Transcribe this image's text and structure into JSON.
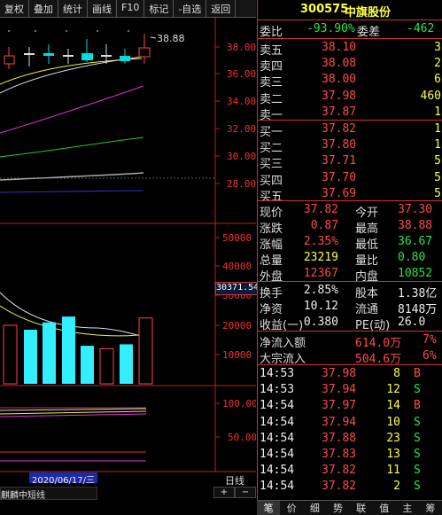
{
  "toolbar": [
    "复权",
    "叠加",
    "统计",
    "画线",
    "F10",
    "标记",
    "-自选",
    "返回"
  ],
  "chart": {
    "price_axis": [
      "38.00",
      "36.00",
      "34.00",
      "32.00",
      "30.00",
      "28.00"
    ],
    "high_marker": "38.88",
    "vol_axis": [
      "50000",
      "40000",
      "30000",
      "20000",
      "10000"
    ],
    "vol_readout": "30371.54",
    "ind_axis": [
      "100.00",
      "50.00"
    ],
    "date_label": "2020/06/17/三",
    "indicator_name": "麒麟中短线",
    "period_label": "日线",
    "volumes": [
      20000,
      18500,
      21000,
      23000,
      13000,
      12000,
      13500,
      22500
    ],
    "vol_colors": [
      "red",
      "cyan",
      "cyan",
      "cyan",
      "cyan",
      "red",
      "cyan",
      "red"
    ]
  },
  "chart_data": {
    "type": "bar",
    "categories": [
      "1",
      "2",
      "3",
      "4",
      "5",
      "6",
      "7",
      "8"
    ],
    "series": [
      {
        "values": [
          20000,
          18500,
          21000,
          23000,
          13000,
          12000,
          13500,
          22500
        ]
      }
    ],
    "ylim": [
      0,
      55000
    ]
  },
  "stock": {
    "code": "300575",
    "name": "中旗股份"
  },
  "ratio": {
    "l1": "委比",
    "v1": "-93.90%",
    "l2": "委差",
    "v2": "-462"
  },
  "asks": [
    {
      "label": "卖五",
      "price": "38.10",
      "vol": "3"
    },
    {
      "label": "卖四",
      "price": "38.08",
      "vol": "2"
    },
    {
      "label": "卖三",
      "price": "38.00",
      "vol": "6"
    },
    {
      "label": "卖二",
      "price": "37.98",
      "vol": "460"
    },
    {
      "label": "卖一",
      "price": "37.87",
      "vol": "1"
    }
  ],
  "bids": [
    {
      "label": "买一",
      "price": "37.82",
      "vol": "1"
    },
    {
      "label": "买二",
      "price": "37.80",
      "vol": "1"
    },
    {
      "label": "买三",
      "price": "37.71",
      "vol": "5"
    },
    {
      "label": "买四",
      "price": "37.70",
      "vol": "5"
    },
    {
      "label": "买五",
      "price": "37.69",
      "vol": "5"
    }
  ],
  "quote": [
    {
      "l1": "现价",
      "v1": "37.82",
      "c1": "red",
      "l2": "今开",
      "v2": "37.30",
      "c2": "red"
    },
    {
      "l1": "涨跌",
      "v1": "0.87",
      "c1": "red",
      "l2": "最高",
      "v2": "38.88",
      "c2": "red"
    },
    {
      "l1": "涨幅",
      "v1": "2.35%",
      "c1": "red",
      "l2": "最低",
      "v2": "36.67",
      "c2": "green"
    },
    {
      "l1": "总量",
      "v1": "23219",
      "c1": "yel",
      "l2": "量比",
      "v2": "0.80",
      "c2": "green"
    },
    {
      "l1": "外盘",
      "v1": "12367",
      "c1": "red",
      "l2": "内盘",
      "v2": "10852",
      "c2": "green"
    }
  ],
  "fundamentals": [
    {
      "l1": "换手",
      "v1": "2.85%",
      "l2": "股本",
      "v2": "1.38亿"
    },
    {
      "l1": "净资",
      "v1": "10.12",
      "l2": "流通",
      "v2": "8148万"
    },
    {
      "l1": "收益(一)",
      "v1": "0.380",
      "l2": "PE(动)",
      "v2": "26.0"
    }
  ],
  "flows": [
    {
      "label": "净流入额",
      "value": "614.0万",
      "pct": "7%"
    },
    {
      "label": "大宗流入",
      "value": "504.6万",
      "pct": "6%"
    }
  ],
  "ticks": [
    {
      "time": "14:53",
      "price": "37.98",
      "vol": "8",
      "dir": "B"
    },
    {
      "time": "14:53",
      "price": "37.94",
      "vol": "12",
      "dir": "S"
    },
    {
      "time": "14:54",
      "price": "37.97",
      "vol": "14",
      "dir": "B"
    },
    {
      "time": "14:54",
      "price": "37.94",
      "vol": "10",
      "dir": "S"
    },
    {
      "time": "14:54",
      "price": "37.88",
      "vol": "23",
      "dir": "S"
    },
    {
      "time": "14:54",
      "price": "37.83",
      "vol": "13",
      "dir": "S"
    },
    {
      "time": "14:54",
      "price": "37.82",
      "vol": "11",
      "dir": "S"
    },
    {
      "time": "14:54",
      "price": "37.82",
      "vol": "2",
      "dir": "S"
    }
  ],
  "tabs": [
    "笔",
    "价",
    "细",
    "势",
    "联",
    "值",
    "主",
    "筹"
  ]
}
